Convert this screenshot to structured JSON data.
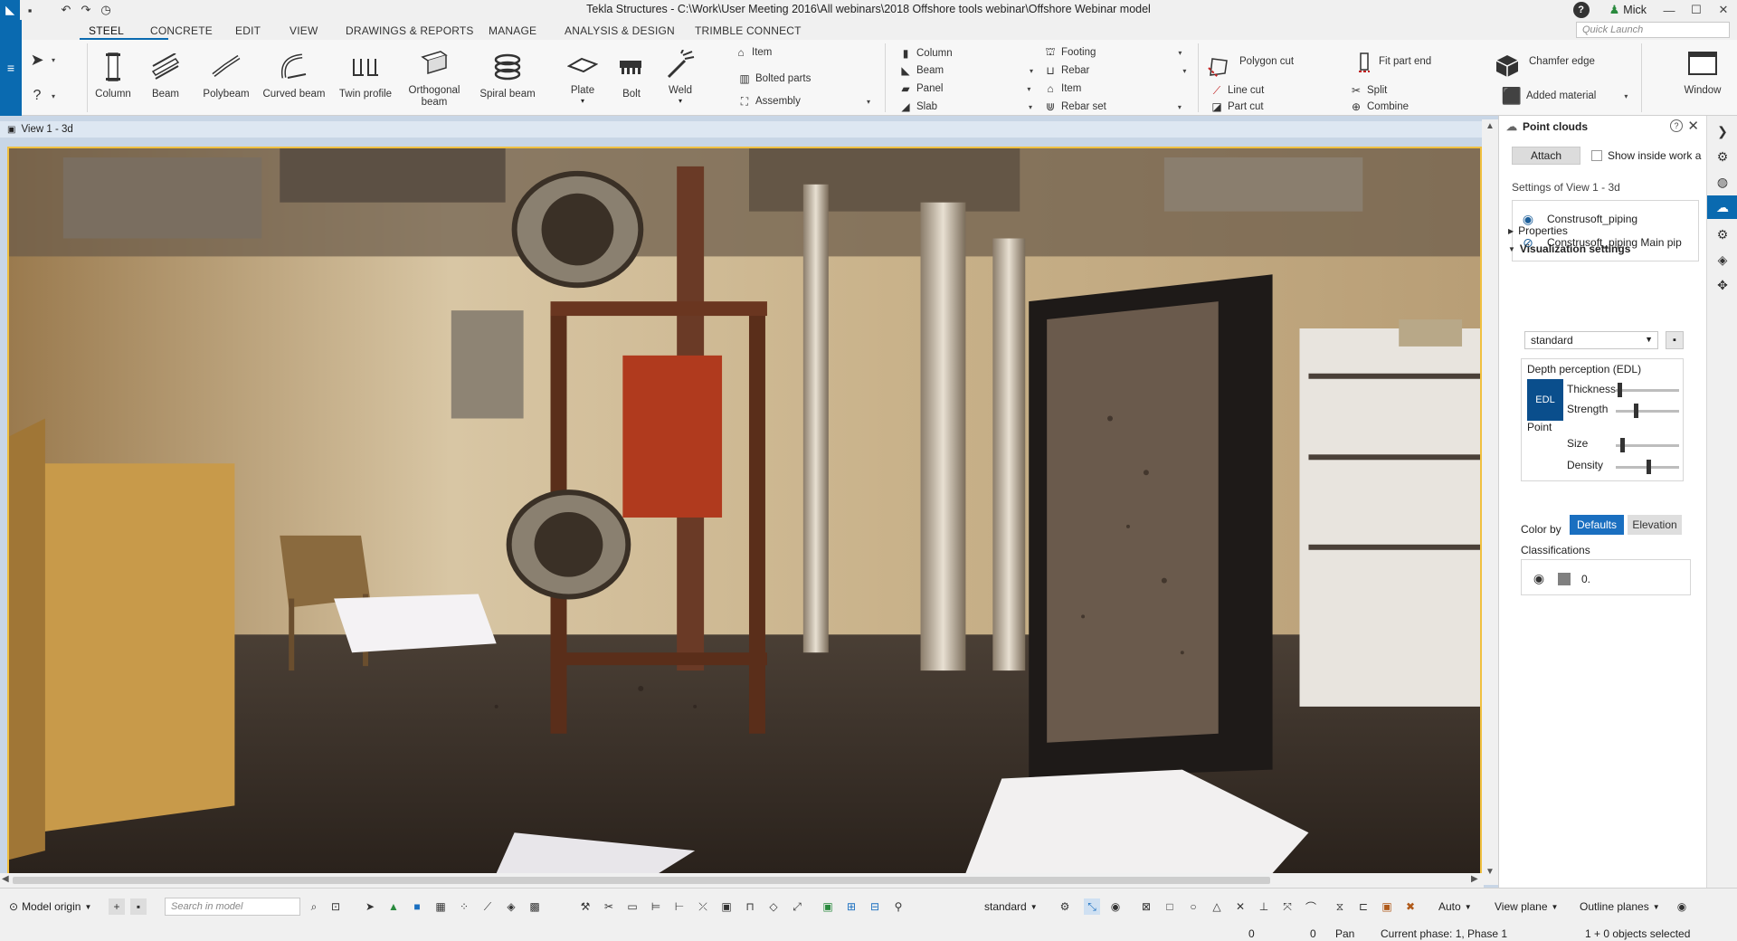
{
  "app": {
    "title": "Tekla Structures - C:\\Work\\User Meeting 2016\\All webinars\\2018 Offshore tools webinar\\Offshore Webinar model",
    "logo_icon": "tekla-logo-icon",
    "user": "Mick",
    "accent": "#0a6ab0"
  },
  "menu_tabs": [
    "STEEL",
    "CONCRETE",
    "EDIT",
    "VIEW",
    "DRAWINGS & REPORTS",
    "MANAGE",
    "ANALYSIS & DESIGN",
    "TRIMBLE CONNECT"
  ],
  "quick_launch": {
    "placeholder": "Quick Launch"
  },
  "ribbon": {
    "steel_buttons": [
      "Column",
      "Beam",
      "Polybeam",
      "Curved beam",
      "Twin profile",
      "Orthogonal\nbeam",
      "Spiral beam",
      "Plate",
      "Bolt",
      "Weld"
    ],
    "steel_small": [
      "Item",
      "Bolted parts",
      "Assembly"
    ],
    "concrete_left": [
      "Column",
      "Beam",
      "Panel",
      "Slab"
    ],
    "concrete_right": [
      "Footing",
      "Rebar",
      "Item",
      "Rebar set"
    ],
    "edit_a": {
      "large": "Polygon cut",
      "small": [
        "Line cut",
        "Part cut"
      ]
    },
    "edit_b": {
      "large": "Fit part end",
      "small": [
        "Split",
        "Combine"
      ]
    },
    "edit_c": {
      "large": "Chamfer edge",
      "small": "Added material"
    },
    "window": "Window"
  },
  "view": {
    "title": "View 1 - 3d"
  },
  "point_clouds_panel": {
    "title": "Point clouds",
    "attach": "Attach",
    "show_inside": "Show inside work a",
    "settings_of": "Settings of View 1 - 3d",
    "clouds": [
      {
        "name": "Construsoft_piping",
        "visible": true
      },
      {
        "name": "Construsoft_piping Main pip",
        "visible": false
      }
    ],
    "properties": "Properties",
    "visualization": "Visualization settings",
    "style": "standard",
    "depth_title": "Depth perception (EDL)",
    "edl": "EDL",
    "thickness": {
      "label": "Thickness",
      "value": 0.03
    },
    "strength": {
      "label": "Strength",
      "value": 0.3
    },
    "point_title": "Point",
    "size": {
      "label": "Size",
      "value": 0.08
    },
    "density": {
      "label": "Density",
      "value": 0.52
    },
    "color_by": "Color by",
    "defaults": "Defaults",
    "elevation": "Elevation",
    "classifications": "Classifications",
    "class_item": "0."
  },
  "bottom": {
    "model_origin": "Model origin",
    "search_placeholder": "Search in model",
    "style": "standard",
    "auto": "Auto",
    "view_plane": "View plane",
    "outline_planes": "Outline planes"
  },
  "status": {
    "coord_a": "0",
    "coord_b": "0",
    "mode": "Pan",
    "phase": "Current phase: 1, Phase 1",
    "selection": "1 + 0 objects selected"
  }
}
